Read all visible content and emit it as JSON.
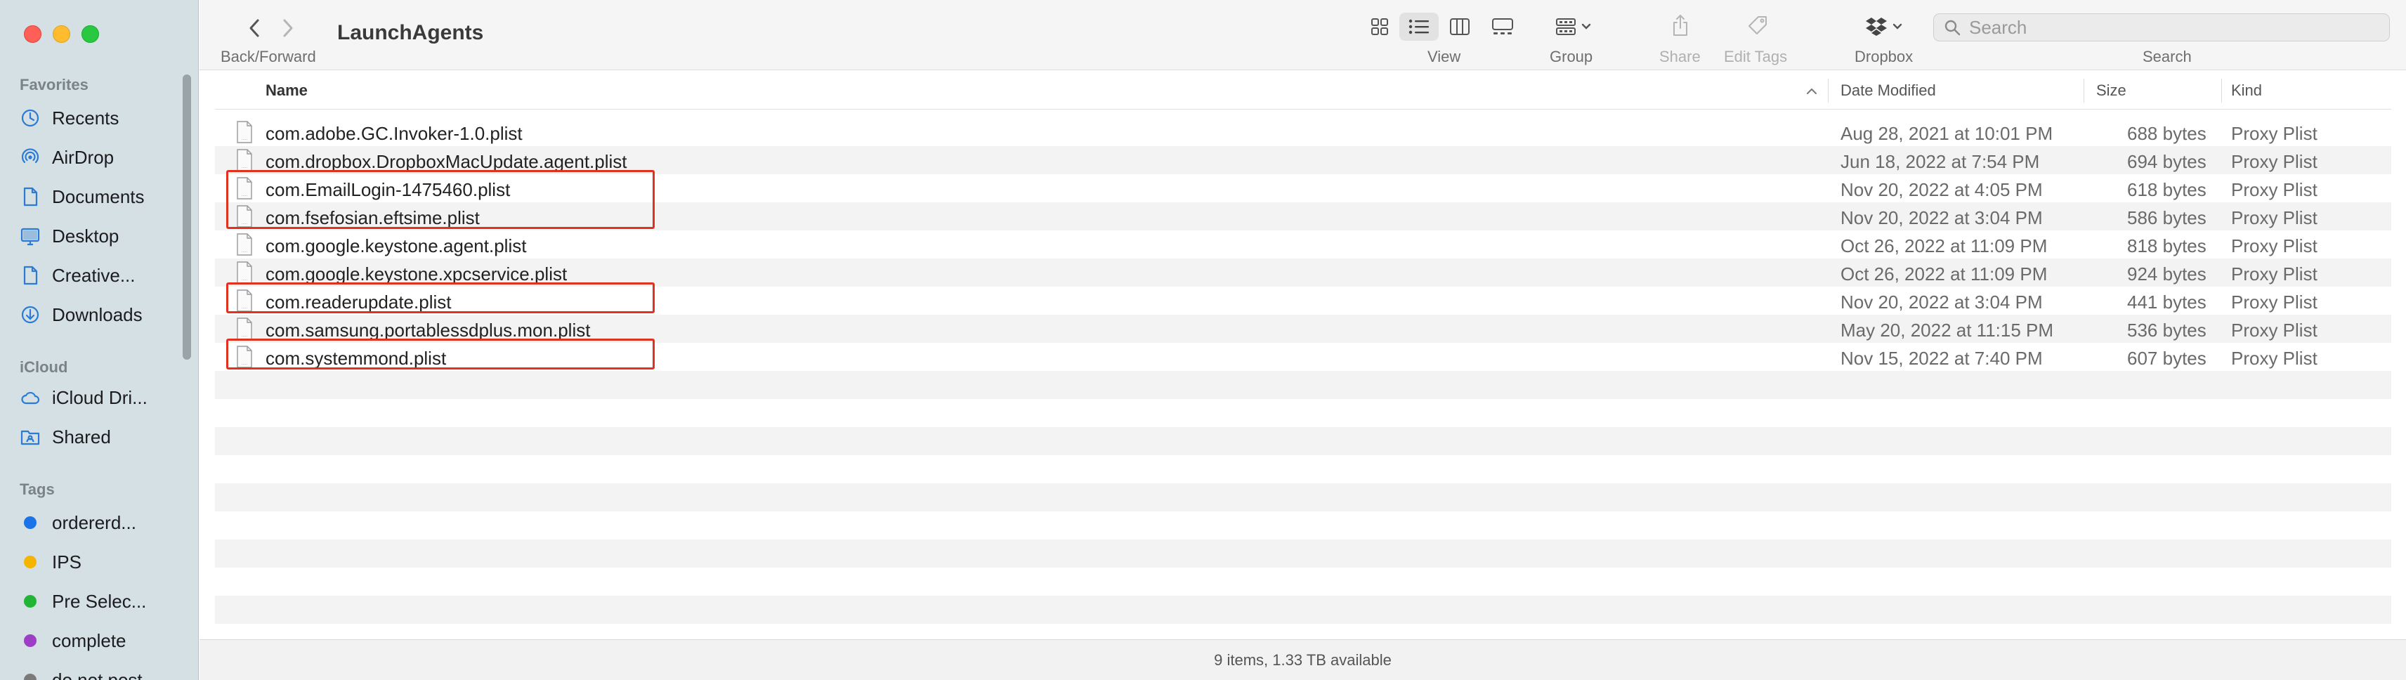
{
  "window": {
    "title": "LaunchAgents"
  },
  "toolbar": {
    "back_forward_label": "Back/Forward",
    "view_label": "View",
    "group_label": "Group",
    "share_label": "Share",
    "edit_tags_label": "Edit Tags",
    "dropbox_label": "Dropbox",
    "search_label": "Search",
    "search_placeholder": "Search",
    "search_value": ""
  },
  "sidebar": {
    "favorites_header": "Favorites",
    "favorites": [
      {
        "label": "Recents",
        "icon": "clock-icon"
      },
      {
        "label": "AirDrop",
        "icon": "airdrop-icon"
      },
      {
        "label": "Documents",
        "icon": "document-icon"
      },
      {
        "label": "Desktop",
        "icon": "desktop-icon"
      },
      {
        "label": "Creative...",
        "icon": "document-icon"
      },
      {
        "label": "Downloads",
        "icon": "download-icon"
      }
    ],
    "icloud_header": "iCloud",
    "icloud": [
      {
        "label": "iCloud Dri...",
        "icon": "cloud-icon"
      },
      {
        "label": "Shared",
        "icon": "shared-folder-icon"
      }
    ],
    "tags_header": "Tags",
    "tags": [
      {
        "label": "ordererd...",
        "color": "#1a73e8"
      },
      {
        "label": "IPS",
        "color": "#f5b400"
      },
      {
        "label": "Pre Selec...",
        "color": "#22b535"
      },
      {
        "label": "complete",
        "color": "#9c3fc6"
      },
      {
        "label": "do not post",
        "color": "#7a7a7a"
      }
    ]
  },
  "columns": {
    "name": "Name",
    "date_modified": "Date Modified",
    "size": "Size",
    "kind": "Kind"
  },
  "files": [
    {
      "name": "com.adobe.GC.Invoker-1.0.plist",
      "date": "Aug 28, 2021 at 10:01 PM",
      "size": "688 bytes",
      "kind": "Proxy Plist",
      "highlighted": false
    },
    {
      "name": "com.dropbox.DropboxMacUpdate.agent.plist",
      "date": "Jun 18, 2022 at 7:54 PM",
      "size": "694 bytes",
      "kind": "Proxy Plist",
      "highlighted": false
    },
    {
      "name": "com.EmailLogin-1475460.plist",
      "date": "Nov 20, 2022 at 4:05 PM",
      "size": "618 bytes",
      "kind": "Proxy Plist",
      "highlighted": true
    },
    {
      "name": "com.fsefosian.eftsime.plist",
      "date": "Nov 20, 2022 at 3:04 PM",
      "size": "586 bytes",
      "kind": "Proxy Plist",
      "highlighted": true
    },
    {
      "name": "com.google.keystone.agent.plist",
      "date": "Oct 26, 2022 at 11:09 PM",
      "size": "818 bytes",
      "kind": "Proxy Plist",
      "highlighted": false
    },
    {
      "name": "com.google.keystone.xpcservice.plist",
      "date": "Oct 26, 2022 at 11:09 PM",
      "size": "924 bytes",
      "kind": "Proxy Plist",
      "highlighted": false
    },
    {
      "name": "com.readerupdate.plist",
      "date": "Nov 20, 2022 at 3:04 PM",
      "size": "441 bytes",
      "kind": "Proxy Plist",
      "highlighted": true
    },
    {
      "name": "com.samsung.portablessdplus.mon.plist",
      "date": "May 20, 2022 at 11:15 PM",
      "size": "536 bytes",
      "kind": "Proxy Plist",
      "highlighted": false
    },
    {
      "name": "com.systemmond.plist",
      "date": "Nov 15, 2022 at 7:40 PM",
      "size": "607 bytes",
      "kind": "Proxy Plist",
      "highlighted": true
    }
  ],
  "status": {
    "text": "9 items, 1.33 TB available"
  },
  "colors": {
    "highlight": "#e0321f",
    "sidebar_bg": "#d4e0e4"
  }
}
